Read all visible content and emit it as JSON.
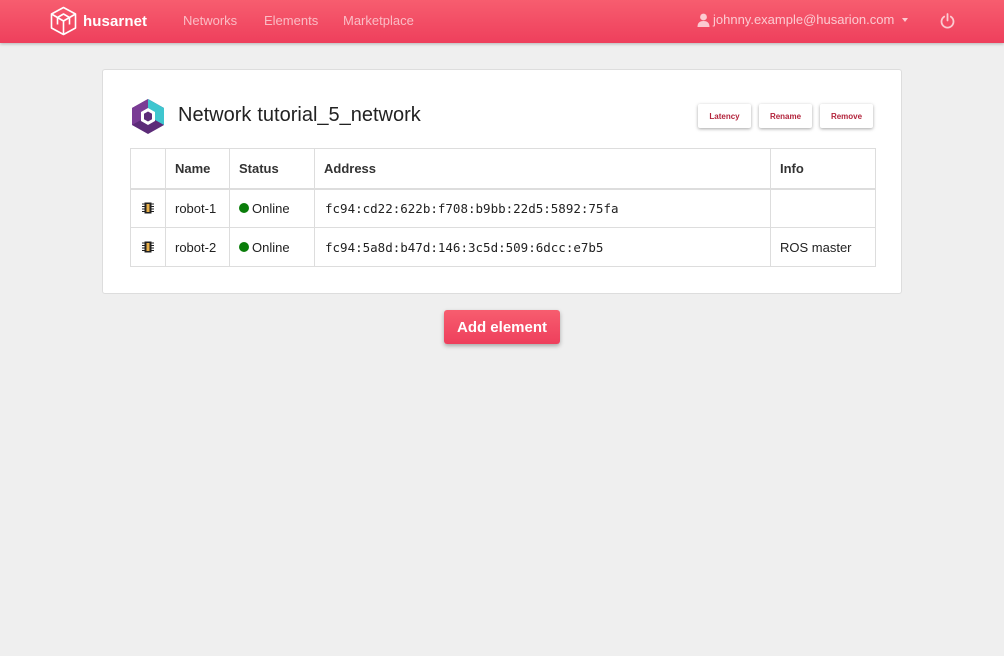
{
  "navbar": {
    "brand": "husarnet",
    "links": [
      "Networks",
      "Elements",
      "Marketplace"
    ],
    "user_email": "johnny.example@husarion.com",
    "power_icon": "power-icon",
    "accent": "#ee3f5c"
  },
  "network": {
    "title_prefix": "Network",
    "name": "tutorial_5_network",
    "buttons": {
      "latency": "Latency",
      "rename": "Rename",
      "remove": "Remove"
    }
  },
  "table": {
    "headers": [
      "",
      "Name",
      "Status",
      "Address",
      "Info"
    ],
    "rows": [
      {
        "icon": "chip-icon",
        "name": "robot-1",
        "status": "Online",
        "address": "fc94:cd22:622b:f708:b9bb:22d5:5892:75fa",
        "info": ""
      },
      {
        "icon": "chip-icon",
        "name": "robot-2",
        "status": "Online",
        "address": "fc94:5a8d:b47d:146:3c5d:509:6dcc:e7b5",
        "info": "ROS master"
      }
    ],
    "status_color": "#0a7d0a"
  },
  "actions": {
    "add_element": "Add element"
  }
}
